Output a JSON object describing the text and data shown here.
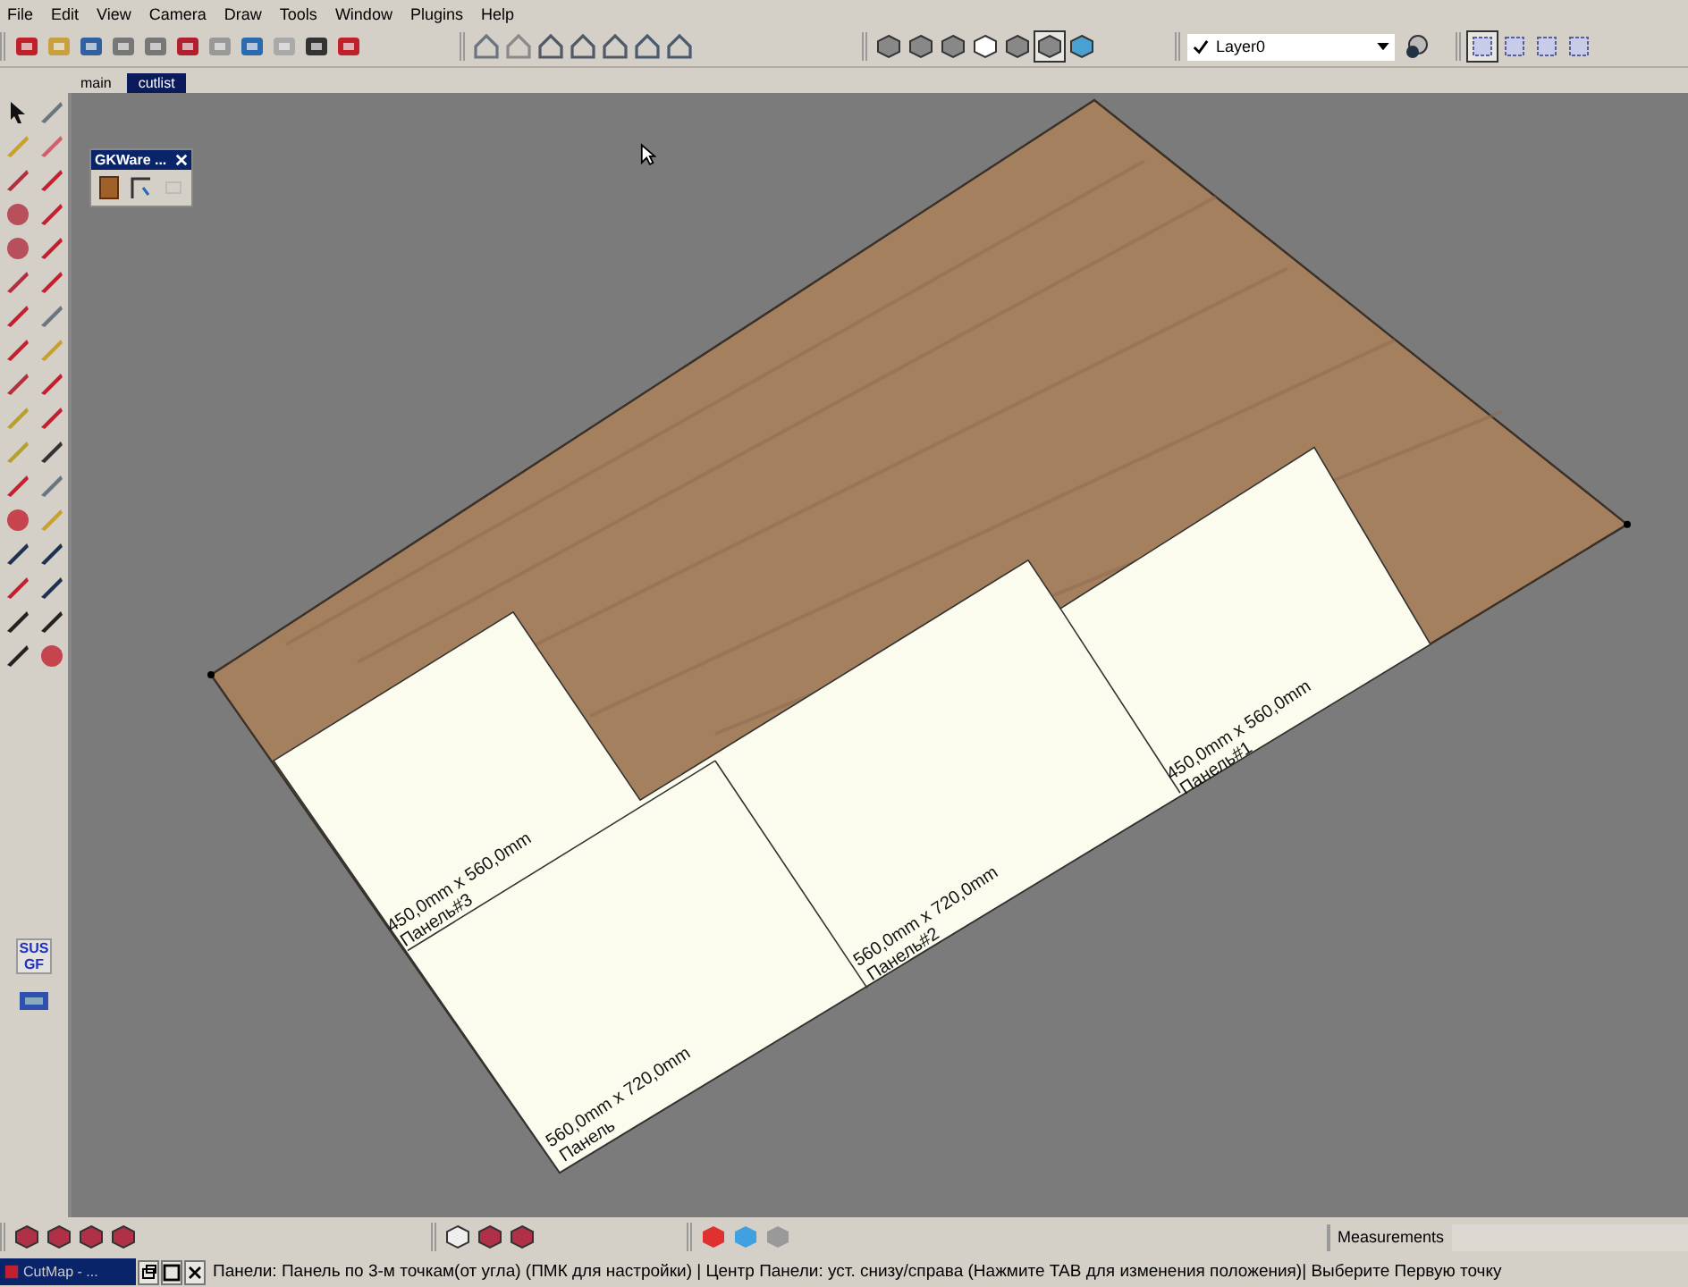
{
  "menu": [
    "File",
    "Edit",
    "View",
    "Camera",
    "Draw",
    "Tools",
    "Window",
    "Plugins",
    "Help"
  ],
  "tabs": [
    {
      "label": "main",
      "selected": false
    },
    {
      "label": "cutlist",
      "selected": true
    }
  ],
  "layer": {
    "name": "Layer0"
  },
  "floating_window": {
    "title": "GKWare ..."
  },
  "side_button": {
    "label": "SUS GF"
  },
  "panels": [
    {
      "size": "450,0mm x 560,0mm",
      "name": "Панель#3"
    },
    {
      "size": "560,0mm x 720,0mm",
      "name": "Панель"
    },
    {
      "size": "560,0mm x 720,0mm",
      "name": "Панель#2"
    },
    {
      "size": "450,0mm x 560,0mm",
      "name": "Панель#1"
    }
  ],
  "measurements": {
    "label": "Measurements"
  },
  "taskbar": {
    "title": "CutMap - ..."
  },
  "status_bar": "Панели: Панель по 3-м точкам(от угла) (ПМК для настройки)  | Центр Панели: уст. снизу/справа (Нажмите TAB для изменения положения)| Выберите Первую точку"
}
